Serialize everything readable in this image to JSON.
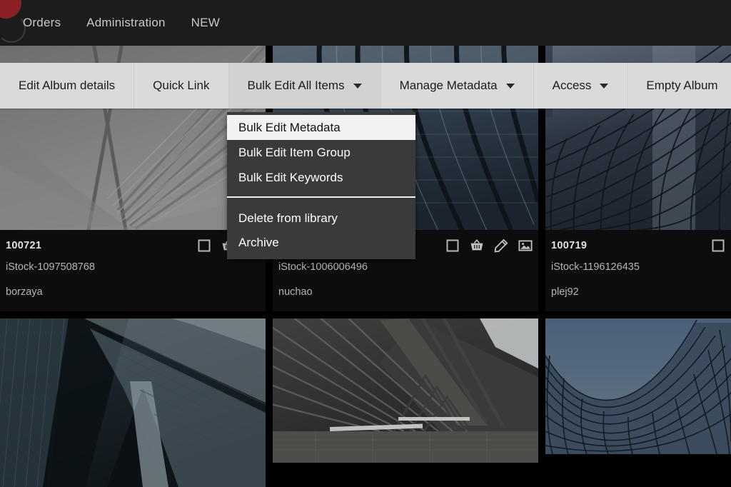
{
  "topnav": {
    "logo_color": "#8c2026",
    "items": [
      {
        "label": "Orders"
      },
      {
        "label": "Administration"
      },
      {
        "label": "NEW"
      }
    ]
  },
  "toolbar": {
    "background": "#dadada",
    "items": [
      {
        "label": "Edit Album details",
        "has_caret": false,
        "active": false
      },
      {
        "label": "Quick Link",
        "has_caret": false,
        "active": false
      },
      {
        "label": "Bulk Edit All Items",
        "has_caret": true,
        "active": true
      },
      {
        "label": "Manage Metadata",
        "has_caret": true,
        "active": false
      },
      {
        "label": "Access",
        "has_caret": true,
        "active": false
      },
      {
        "label": "Empty Album",
        "has_caret": false,
        "active": false
      }
    ]
  },
  "dropdown": {
    "open_for": "Bulk Edit All Items",
    "background": "#3a3a3a",
    "highlight_color": "#f2f2f2",
    "group_a": [
      {
        "label": "Bulk Edit Metadata",
        "highlighted": true
      },
      {
        "label": "Bulk Edit Item Group",
        "highlighted": false
      },
      {
        "label": "Bulk Edit Keywords",
        "highlighted": false
      }
    ],
    "group_b": [
      {
        "label": "Delete from library",
        "highlighted": false
      },
      {
        "label": "Archive",
        "highlighted": false
      }
    ]
  },
  "grid": {
    "cards": [
      {
        "id": "100721",
        "filename": "iStock-1097508768",
        "author": "borzaya",
        "icons": [
          "checkbox-icon",
          "basket-icon",
          "pencil-icon"
        ]
      },
      {
        "id": "",
        "filename": "iStock-1006006496",
        "author": "nuchao",
        "icons": [
          "checkbox-icon",
          "basket-icon",
          "pencil-icon",
          "image-icon"
        ]
      },
      {
        "id": "100719",
        "filename": "iStock-1196126435",
        "author": "plej92",
        "icons": [
          "checkbox-icon"
        ]
      },
      {
        "id": "",
        "filename": "",
        "author": "",
        "icons": []
      },
      {
        "id": "",
        "filename": "",
        "author": "",
        "icons": []
      },
      {
        "id": "",
        "filename": "",
        "author": "",
        "icons": []
      }
    ]
  }
}
